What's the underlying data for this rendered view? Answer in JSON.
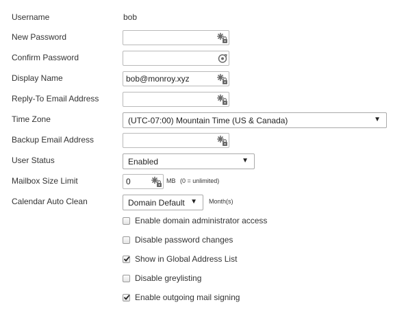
{
  "fields": {
    "username": {
      "label": "Username",
      "value": "bob"
    },
    "new_password": {
      "label": "New Password",
      "value": "",
      "icon": "key-lock-icon"
    },
    "confirm_password": {
      "label": "Confirm Password",
      "value": "",
      "icon": "refresh-icon"
    },
    "display_name": {
      "label": "Display Name",
      "value": "bob@monroy.xyz",
      "icon": "key-lock-icon"
    },
    "reply_to": {
      "label": "Reply-To Email Address",
      "value": "",
      "icon": "key-lock-icon"
    },
    "time_zone": {
      "label": "Time Zone",
      "value": "(UTC-07:00) Mountain Time (US & Canada)",
      "caret": "▼"
    },
    "backup_email": {
      "label": "Backup Email Address",
      "value": "",
      "icon": "key-lock-icon"
    },
    "user_status": {
      "label": "User Status",
      "value": "Enabled",
      "caret": "▼"
    },
    "mailbox_limit": {
      "label": "Mailbox Size Limit",
      "value": "0",
      "unit": "MB",
      "hint": "(0 = unlimited)",
      "icon": "key-lock-icon"
    },
    "calendar_clean": {
      "label": "Calendar Auto Clean",
      "value": "Domain Default",
      "caret": "▼",
      "unit": "Month(s)"
    }
  },
  "options": [
    {
      "label": "Enable domain administrator access",
      "checked": false
    },
    {
      "label": "Disable password changes",
      "checked": false
    },
    {
      "label": "Show in Global Address List",
      "checked": true
    },
    {
      "label": "Disable greylisting",
      "checked": false
    },
    {
      "label": "Enable outgoing mail signing",
      "checked": true
    }
  ],
  "colors": {
    "text": "#333333",
    "border": "#b9b9b9",
    "icon": "#6a6a6a"
  }
}
